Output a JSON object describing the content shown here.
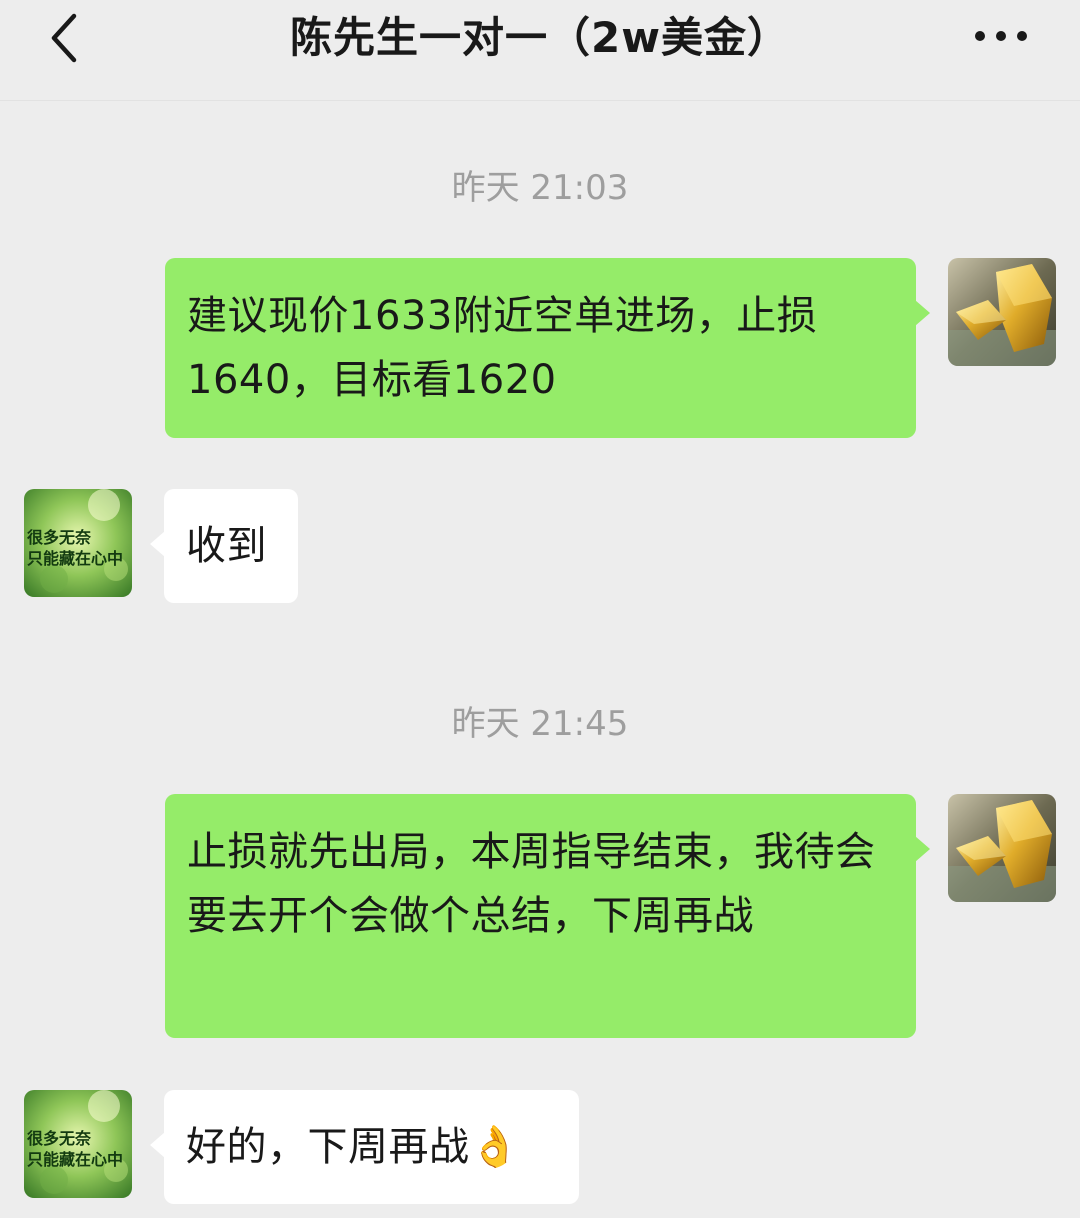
{
  "header": {
    "title": "陈先生一对一（2w美金）",
    "back_icon": "chevron-left-icon",
    "more_icon": "more-horizontal-icon"
  },
  "messages": [
    {
      "type": "timestamp",
      "text": "昨天 21:03"
    },
    {
      "type": "outgoing",
      "text": "建议现价1633附近空单进场，止损1640，目标看1620",
      "avatar": "gold-bar-avatar"
    },
    {
      "type": "incoming",
      "text": "收到",
      "avatar": "green-avatar"
    },
    {
      "type": "timestamp",
      "text": "昨天 21:45"
    },
    {
      "type": "outgoing",
      "text": "止损就先出局，本周指导结束，我待会要去开个会做个总结，下周再战",
      "avatar": "gold-bar-avatar"
    },
    {
      "type": "incoming",
      "text": "好的，下周再战",
      "emoji": "👌",
      "avatar": "green-avatar"
    }
  ],
  "contact_avatar": {
    "line1": "很多无奈",
    "line2": "只能藏在心中"
  },
  "colors": {
    "background": "#ededed",
    "outgoing_bubble": "#95ec69",
    "incoming_bubble": "#ffffff",
    "timestamp_text": "#9e9e9e"
  }
}
